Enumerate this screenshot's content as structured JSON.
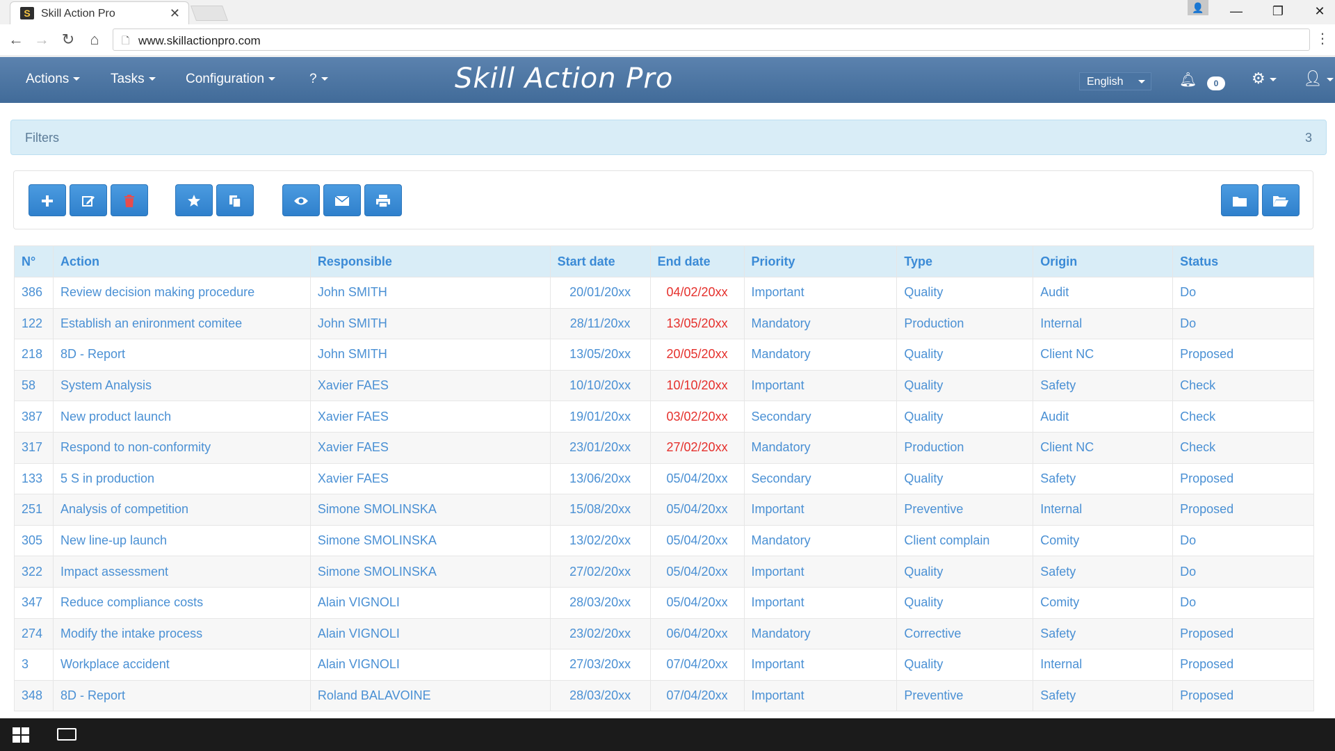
{
  "browser": {
    "tab_title": "Skill Action Pro",
    "favicon_letter": "S",
    "url": "www.skillactionpro.com"
  },
  "navbar": {
    "menus": [
      "Actions",
      "Tasks",
      "Configuration",
      "?"
    ],
    "brand": "Skill Action Pro",
    "language": "English",
    "notification_count": "0"
  },
  "filters": {
    "title": "Filters",
    "count": "3"
  },
  "toolbar": {
    "buttons": [
      "add-icon",
      "edit-icon",
      "trash-icon",
      "star-icon",
      "copy-icon",
      "eye-icon",
      "envelope-icon",
      "print-icon",
      "folder-icon",
      "folder-open-icon"
    ]
  },
  "table": {
    "headers": [
      "N°",
      "Action",
      "Responsible",
      "Start date",
      "End date",
      "Priority",
      "Type",
      "Origin",
      "Status"
    ],
    "rows": [
      {
        "n": "386",
        "action": "Review decision making procedure",
        "responsible": "John SMITH",
        "start": "20/01/20xx",
        "end": "04/02/20xx",
        "late": true,
        "priority": "Important",
        "type": "Quality",
        "origin": "Audit",
        "status": "Do"
      },
      {
        "n": "122",
        "action": "Establish an enironment comitee",
        "responsible": "John SMITH",
        "start": "28/11/20xx",
        "end": "13/05/20xx",
        "late": true,
        "priority": "Mandatory",
        "type": "Production",
        "origin": "Internal",
        "status": "Do"
      },
      {
        "n": "218",
        "action": "8D - Report",
        "responsible": "John SMITH",
        "start": "13/05/20xx",
        "end": "20/05/20xx",
        "late": true,
        "priority": "Mandatory",
        "type": "Quality",
        "origin": "Client NC",
        "status": "Proposed"
      },
      {
        "n": "58",
        "action": "System Analysis",
        "responsible": "Xavier FAES",
        "start": "10/10/20xx",
        "end": "10/10/20xx",
        "late": true,
        "priority": "Important",
        "type": "Quality",
        "origin": "Safety",
        "status": "Check"
      },
      {
        "n": "387",
        "action": "New product launch",
        "responsible": "Xavier FAES",
        "start": "19/01/20xx",
        "end": "03/02/20xx",
        "late": true,
        "priority": "Secondary",
        "type": "Quality",
        "origin": "Audit",
        "status": "Check"
      },
      {
        "n": "317",
        "action": "Respond to non-conformity",
        "responsible": "Xavier FAES",
        "start": "23/01/20xx",
        "end": "27/02/20xx",
        "late": true,
        "priority": "Mandatory",
        "type": "Production",
        "origin": "Client NC",
        "status": "Check"
      },
      {
        "n": "133",
        "action": "5 S in production",
        "responsible": "Xavier FAES",
        "start": "13/06/20xx",
        "end": "05/04/20xx",
        "late": false,
        "priority": "Secondary",
        "type": "Quality",
        "origin": "Safety",
        "status": "Proposed"
      },
      {
        "n": "251",
        "action": "Analysis of competition",
        "responsible": "Simone SMOLINSKA",
        "start": "15/08/20xx",
        "end": "05/04/20xx",
        "late": false,
        "priority": "Important",
        "type": "Preventive",
        "origin": "Internal",
        "status": "Proposed"
      },
      {
        "n": "305",
        "action": "New line-up launch",
        "responsible": "Simone SMOLINSKA",
        "start": "13/02/20xx",
        "end": "05/04/20xx",
        "late": false,
        "priority": "Mandatory",
        "type": "Client complain",
        "origin": "Comity",
        "status": "Do"
      },
      {
        "n": "322",
        "action": "Impact assessment",
        "responsible": "Simone SMOLINSKA",
        "start": "27/02/20xx",
        "end": "05/04/20xx",
        "late": false,
        "priority": "Important",
        "type": "Quality",
        "origin": "Safety",
        "status": "Do"
      },
      {
        "n": "347",
        "action": "Reduce compliance costs",
        "responsible": "Alain VIGNOLI",
        "start": "28/03/20xx",
        "end": "05/04/20xx",
        "late": false,
        "priority": "Important",
        "type": "Quality",
        "origin": "Comity",
        "status": "Do"
      },
      {
        "n": "274",
        "action": "Modify the intake process",
        "responsible": "Alain VIGNOLI",
        "start": "23/02/20xx",
        "end": "06/04/20xx",
        "late": false,
        "priority": "Mandatory",
        "type": "Corrective",
        "origin": "Safety",
        "status": "Proposed"
      },
      {
        "n": "3",
        "action": "Workplace accident",
        "responsible": "Alain VIGNOLI",
        "start": "27/03/20xx",
        "end": "07/04/20xx",
        "late": false,
        "priority": "Important",
        "type": "Quality",
        "origin": "Internal",
        "status": "Proposed"
      },
      {
        "n": "348",
        "action": "8D - Report",
        "responsible": "Roland BALAVOINE",
        "start": "28/03/20xx",
        "end": "07/04/20xx",
        "late": false,
        "priority": "Important",
        "type": "Preventive",
        "origin": "Safety",
        "status": "Proposed"
      }
    ]
  },
  "colors": {
    "navbar": "#4d77a5",
    "link_blue": "#4a90d4",
    "late_red": "#e5302c",
    "button_blue": "#3a8ad6",
    "filter_bg": "#d9edf7"
  }
}
